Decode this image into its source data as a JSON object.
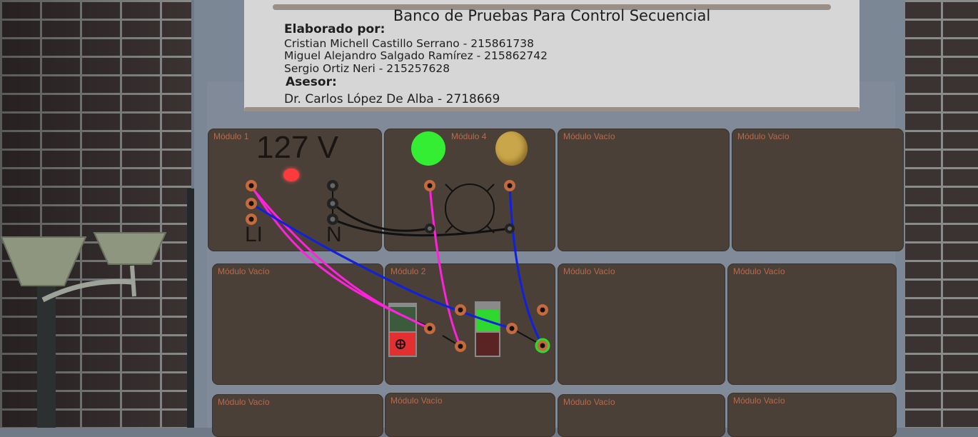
{
  "sign": {
    "title": "Banco de Pruebas Para Control Secuencial",
    "elaborado_label": "Elaborado por:",
    "authors": [
      "Cristian Michell Castillo Serrano - 215861738",
      "Miguel Alejandro Salgado Ramírez - 215862742",
      "Sergio Ortiz Neri - 215257628"
    ],
    "asesor_label": "Asesor:",
    "asesor": "Dr. Carlos López De Alba - 2718669"
  },
  "modules": {
    "m1": {
      "label": "Módulo 1",
      "voltage": "127 V",
      "line_label": "LI",
      "neutral_label": "N"
    },
    "m4": {
      "label": "Módulo 4"
    },
    "m2": {
      "label": "Módulo 2"
    },
    "empty_label": "Módulo Vacío"
  },
  "colors": {
    "wire_magenta": "#ff22dd",
    "wire_blue": "#1020e0",
    "wire_black": "#111111",
    "indicator_red": "#ff3a3a",
    "lamp_green": "#33ee33",
    "lamp_yellow": "#c9a64a",
    "button_red": "#e23030",
    "button_green": "#2ed82e"
  }
}
